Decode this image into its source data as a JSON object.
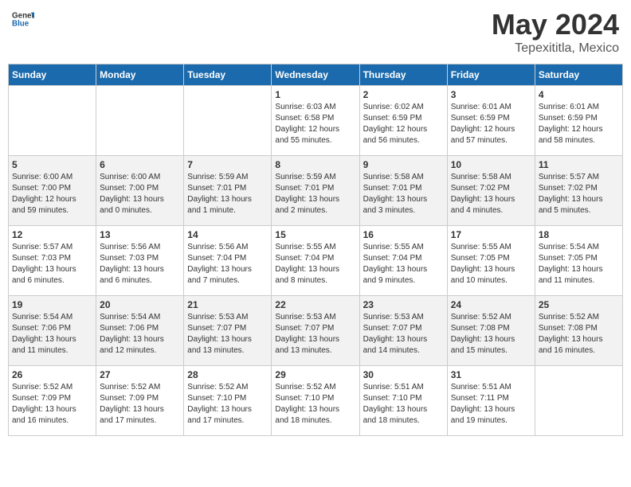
{
  "header": {
    "logo_general": "General",
    "logo_blue": "Blue",
    "month": "May 2024",
    "location": "Tepexititla, Mexico"
  },
  "weekdays": [
    "Sunday",
    "Monday",
    "Tuesday",
    "Wednesday",
    "Thursday",
    "Friday",
    "Saturday"
  ],
  "weeks": [
    [
      {
        "day": "",
        "info": ""
      },
      {
        "day": "",
        "info": ""
      },
      {
        "day": "",
        "info": ""
      },
      {
        "day": "1",
        "info": "Sunrise: 6:03 AM\nSunset: 6:58 PM\nDaylight: 12 hours\nand 55 minutes."
      },
      {
        "day": "2",
        "info": "Sunrise: 6:02 AM\nSunset: 6:59 PM\nDaylight: 12 hours\nand 56 minutes."
      },
      {
        "day": "3",
        "info": "Sunrise: 6:01 AM\nSunset: 6:59 PM\nDaylight: 12 hours\nand 57 minutes."
      },
      {
        "day": "4",
        "info": "Sunrise: 6:01 AM\nSunset: 6:59 PM\nDaylight: 12 hours\nand 58 minutes."
      }
    ],
    [
      {
        "day": "5",
        "info": "Sunrise: 6:00 AM\nSunset: 7:00 PM\nDaylight: 12 hours\nand 59 minutes."
      },
      {
        "day": "6",
        "info": "Sunrise: 6:00 AM\nSunset: 7:00 PM\nDaylight: 13 hours\nand 0 minutes."
      },
      {
        "day": "7",
        "info": "Sunrise: 5:59 AM\nSunset: 7:01 PM\nDaylight: 13 hours\nand 1 minute."
      },
      {
        "day": "8",
        "info": "Sunrise: 5:59 AM\nSunset: 7:01 PM\nDaylight: 13 hours\nand 2 minutes."
      },
      {
        "day": "9",
        "info": "Sunrise: 5:58 AM\nSunset: 7:01 PM\nDaylight: 13 hours\nand 3 minutes."
      },
      {
        "day": "10",
        "info": "Sunrise: 5:58 AM\nSunset: 7:02 PM\nDaylight: 13 hours\nand 4 minutes."
      },
      {
        "day": "11",
        "info": "Sunrise: 5:57 AM\nSunset: 7:02 PM\nDaylight: 13 hours\nand 5 minutes."
      }
    ],
    [
      {
        "day": "12",
        "info": "Sunrise: 5:57 AM\nSunset: 7:03 PM\nDaylight: 13 hours\nand 6 minutes."
      },
      {
        "day": "13",
        "info": "Sunrise: 5:56 AM\nSunset: 7:03 PM\nDaylight: 13 hours\nand 6 minutes."
      },
      {
        "day": "14",
        "info": "Sunrise: 5:56 AM\nSunset: 7:04 PM\nDaylight: 13 hours\nand 7 minutes."
      },
      {
        "day": "15",
        "info": "Sunrise: 5:55 AM\nSunset: 7:04 PM\nDaylight: 13 hours\nand 8 minutes."
      },
      {
        "day": "16",
        "info": "Sunrise: 5:55 AM\nSunset: 7:04 PM\nDaylight: 13 hours\nand 9 minutes."
      },
      {
        "day": "17",
        "info": "Sunrise: 5:55 AM\nSunset: 7:05 PM\nDaylight: 13 hours\nand 10 minutes."
      },
      {
        "day": "18",
        "info": "Sunrise: 5:54 AM\nSunset: 7:05 PM\nDaylight: 13 hours\nand 11 minutes."
      }
    ],
    [
      {
        "day": "19",
        "info": "Sunrise: 5:54 AM\nSunset: 7:06 PM\nDaylight: 13 hours\nand 11 minutes."
      },
      {
        "day": "20",
        "info": "Sunrise: 5:54 AM\nSunset: 7:06 PM\nDaylight: 13 hours\nand 12 minutes."
      },
      {
        "day": "21",
        "info": "Sunrise: 5:53 AM\nSunset: 7:07 PM\nDaylight: 13 hours\nand 13 minutes."
      },
      {
        "day": "22",
        "info": "Sunrise: 5:53 AM\nSunset: 7:07 PM\nDaylight: 13 hours\nand 13 minutes."
      },
      {
        "day": "23",
        "info": "Sunrise: 5:53 AM\nSunset: 7:07 PM\nDaylight: 13 hours\nand 14 minutes."
      },
      {
        "day": "24",
        "info": "Sunrise: 5:52 AM\nSunset: 7:08 PM\nDaylight: 13 hours\nand 15 minutes."
      },
      {
        "day": "25",
        "info": "Sunrise: 5:52 AM\nSunset: 7:08 PM\nDaylight: 13 hours\nand 16 minutes."
      }
    ],
    [
      {
        "day": "26",
        "info": "Sunrise: 5:52 AM\nSunset: 7:09 PM\nDaylight: 13 hours\nand 16 minutes."
      },
      {
        "day": "27",
        "info": "Sunrise: 5:52 AM\nSunset: 7:09 PM\nDaylight: 13 hours\nand 17 minutes."
      },
      {
        "day": "28",
        "info": "Sunrise: 5:52 AM\nSunset: 7:10 PM\nDaylight: 13 hours\nand 17 minutes."
      },
      {
        "day": "29",
        "info": "Sunrise: 5:52 AM\nSunset: 7:10 PM\nDaylight: 13 hours\nand 18 minutes."
      },
      {
        "day": "30",
        "info": "Sunrise: 5:51 AM\nSunset: 7:10 PM\nDaylight: 13 hours\nand 18 minutes."
      },
      {
        "day": "31",
        "info": "Sunrise: 5:51 AM\nSunset: 7:11 PM\nDaylight: 13 hours\nand 19 minutes."
      },
      {
        "day": "",
        "info": ""
      }
    ]
  ]
}
